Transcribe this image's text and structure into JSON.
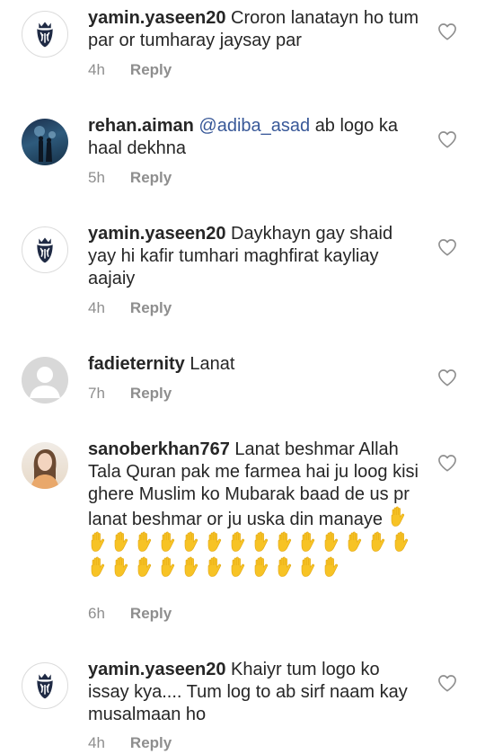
{
  "comments": [
    {
      "username": "yamin.yaseen20",
      "text": "Croron lanatayn ho tum par or tumharay jaysay par",
      "time": "4h",
      "reply_label": "Reply",
      "avatar": "lion-crest-logo"
    },
    {
      "username": "rehan.aiman",
      "mention": "@adiba_asad",
      "text": "ab logo ka haal dekhna",
      "time": "5h",
      "reply_label": "Reply",
      "avatar": "couple-night-photo"
    },
    {
      "username": "yamin.yaseen20",
      "text": "Daykhayn gay shaid yay hi kafir tumhari maghfirat kayliay aajaiy",
      "time": "4h",
      "reply_label": "Reply",
      "avatar": "lion-crest-logo"
    },
    {
      "username": "fadieternity",
      "text": "Lanat",
      "time": "7h",
      "reply_label": "Reply",
      "avatar": "default-avatar"
    },
    {
      "username": "sanoberkhan767",
      "text": "Lanat beshmar Allah Tala Quran pak me farmea hai ju loog kisi ghere Muslim ko Mubarak baad de us pr lanat beshmar or ju uska din manaye",
      "emoji": "raised-hand-emoji",
      "emoji_count": 26,
      "time": "6h",
      "reply_label": "Reply",
      "avatar": "girl-photo"
    },
    {
      "username": "yamin.yaseen20",
      "text": "Khaiyr tum logo ko issay kya.... Tum log to ab sirf naam kay musalmaan ho",
      "time": "4h",
      "reply_label": "Reply",
      "avatar": "lion-crest-logo"
    }
  ],
  "icons": {
    "like": "heart-outline-icon"
  },
  "colors": {
    "text": "#262626",
    "muted": "#8e8e8e",
    "mention": "#385898",
    "emoji": "#f7c325"
  }
}
